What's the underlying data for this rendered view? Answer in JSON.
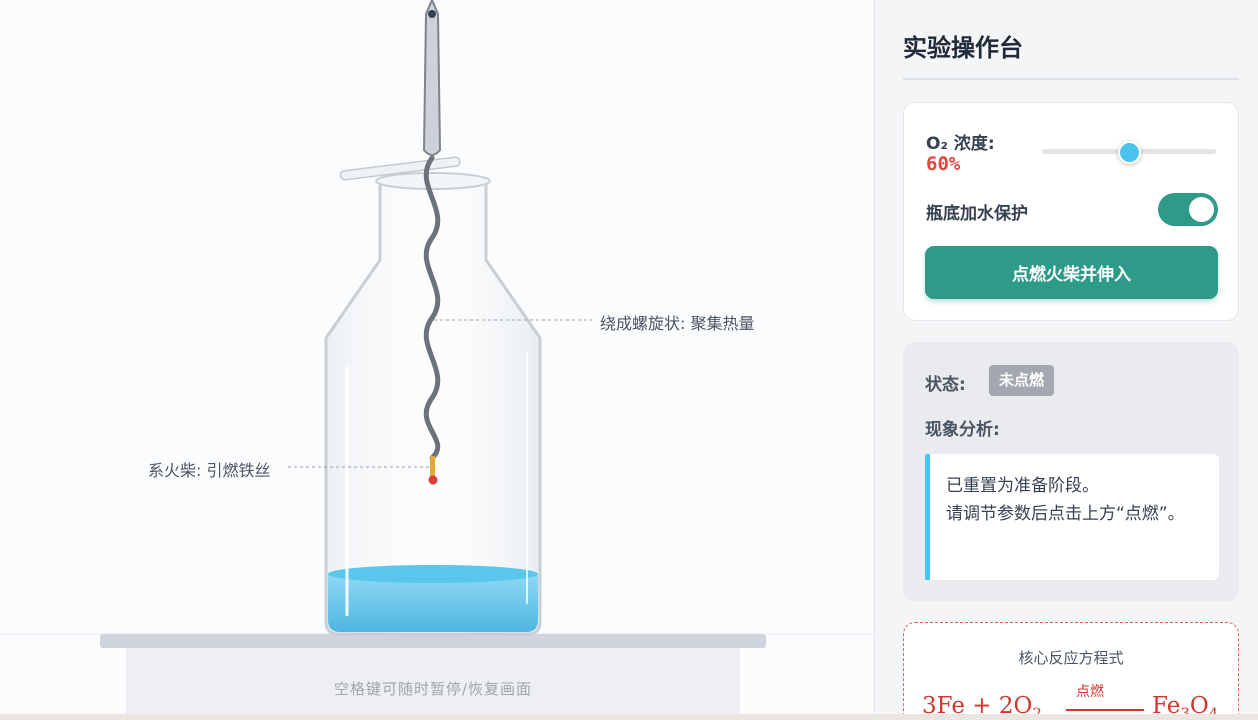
{
  "stage": {
    "annotations": {
      "spiral": "绕成螺旋状: 聚集热量",
      "match": "系火柴: 引燃铁丝"
    },
    "hint": "空格键可随时暂停/恢复画面"
  },
  "panel": {
    "title": "实验操作台",
    "controls": {
      "o2_label": "O₂ 浓度:",
      "o2_value": "60%",
      "o2_level": 0.5,
      "water_label": "瓶底加水保护",
      "water_on": true,
      "ignite_button": "点燃火柴并伸入"
    },
    "status": {
      "label": "状态:",
      "badge": "未点燃",
      "analysis_label": "现象分析:",
      "analysis_lines": [
        "已重置为准备阶段。",
        "请调节参数后点击上方“点燃”。"
      ]
    },
    "equation": {
      "title": "核心反应方程式",
      "left": "3Fe + 2O",
      "left_sub": "2",
      "condition": "点燃",
      "right": "Fe",
      "right_sub1": "3",
      "right_mid": "O",
      "right_sub2": "4"
    }
  },
  "colors": {
    "accent": "#2e9a88",
    "danger": "#e2453b",
    "info": "#4cc3ee",
    "water": "#5bc6ec"
  }
}
